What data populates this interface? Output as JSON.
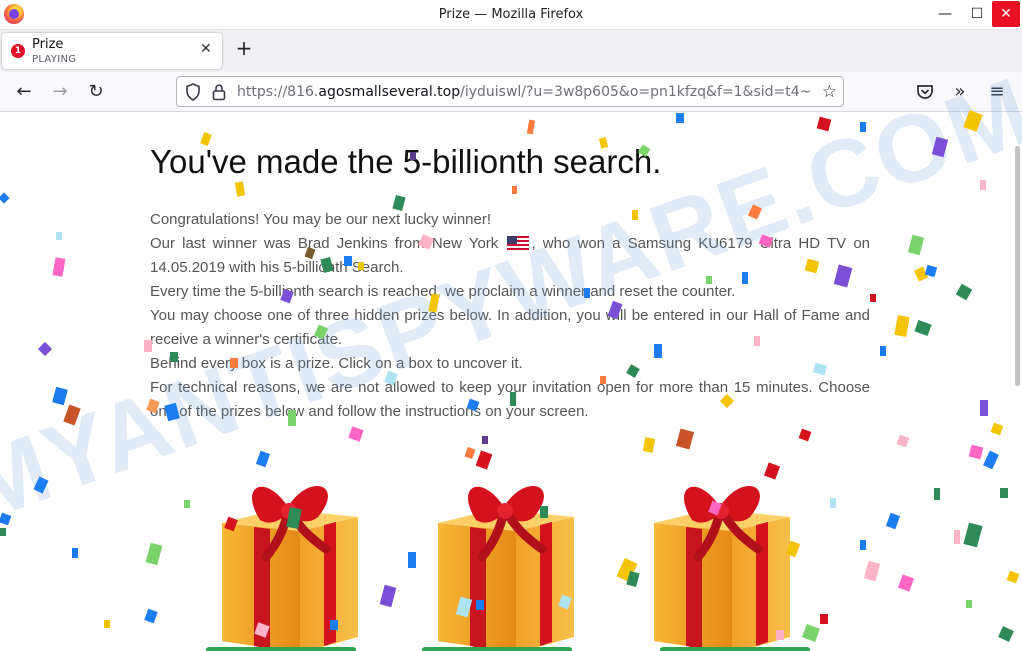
{
  "window": {
    "title": "Prize — Mozilla Firefox",
    "minimize": "—",
    "maximize": "☐",
    "close": "✕"
  },
  "tab": {
    "badge": "1",
    "title": "Prize",
    "status": "PLAYING",
    "close": "✕",
    "new_tab": "+"
  },
  "nav": {
    "back": "←",
    "forward": "→",
    "reload": "↻",
    "url_scheme": "https://816.",
    "url_host": "agosmallseveral.top",
    "url_path": "/iyduiswl/?u=3w8p605&o=pn1kfzq&f=1&sid=t4~",
    "star": "☆",
    "more": "»",
    "menu": "≡"
  },
  "page": {
    "headline": "You've made the 5-billionth search.",
    "lines": {
      "l1": "Congratulations! You may be our next lucky winner!",
      "l2a": "Our last winner was Brad Jenkins from New York",
      "l2b": ", who won a Samsung KU6179 Ultra HD TV on 14.05.2019 with his 5-billionth Search.",
      "l3": "Every time the 5-billionth search is reached, we proclaim a winner and reset the counter.",
      "l4": "You may choose one of three hidden prizes below. In addition, you will be entered in our Hall of Fame and receive a winner's certificate.",
      "l5": "Behind every box is a prize. Click on a box to uncover it.",
      "l6": "For technical reasons, we are not allowed to keep your invitation open for more than 15 minutes. Choose one of the prizes below and follow the instructions on your screen."
    }
  },
  "watermark": {
    "text": "MYANTISPYWARE.COM"
  },
  "colors": {
    "accent_close": "#e81123",
    "gift_ribbon": "#d4121e",
    "gift_box": "#f2a52a",
    "button_green": "#2ea44f"
  }
}
